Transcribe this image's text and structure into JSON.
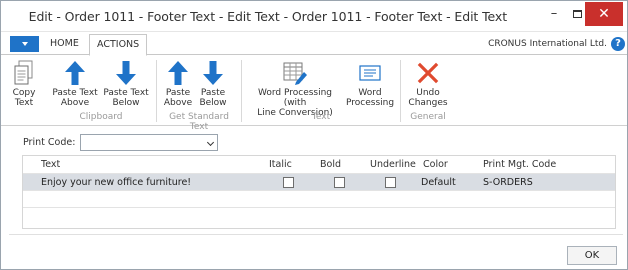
{
  "window": {
    "title": "Edit - Order 1011 - Footer Text - Edit Text - Order 1011 - Footer Text - Edit Text",
    "minimize": "–",
    "close": "✕"
  },
  "tabs": [
    {
      "label": "HOME"
    },
    {
      "label": "ACTIONS"
    }
  ],
  "company": "CRONUS International Ltd.",
  "help": "?",
  "ribbon": {
    "copy_text": "Copy\nText",
    "paste_text_above": "Paste Text\nAbove",
    "paste_text_below": "Paste Text\nBelow",
    "paste_above": "Paste\nAbove",
    "paste_below": "Paste\nBelow",
    "word_processing_conv": "Word Processing (with\nLine Conversion)",
    "word_processing": "Word\nProcessing",
    "undo_changes": "Undo\nChanges",
    "groups": {
      "clipboard": "Clipboard",
      "get_standard_text": "Get Standard Text",
      "text": "Text",
      "general": "General"
    },
    "colors": {
      "blue_arrow": "#1f73c8",
      "undo_red": "#e04a2f"
    }
  },
  "print_code": {
    "label": "Print Code:",
    "value": ""
  },
  "grid": {
    "headers": {
      "text": "Text",
      "italic": "Italic",
      "bold": "Bold",
      "underline": "Underline",
      "color": "Color",
      "print_mgt_code": "Print Mgt. Code"
    },
    "rows": [
      {
        "text": "Enjoy your new office furniture!",
        "italic": false,
        "bold": false,
        "underline": false,
        "color": "Default",
        "print_mgt_code": "S-ORDERS"
      }
    ]
  },
  "ok_label": "OK"
}
